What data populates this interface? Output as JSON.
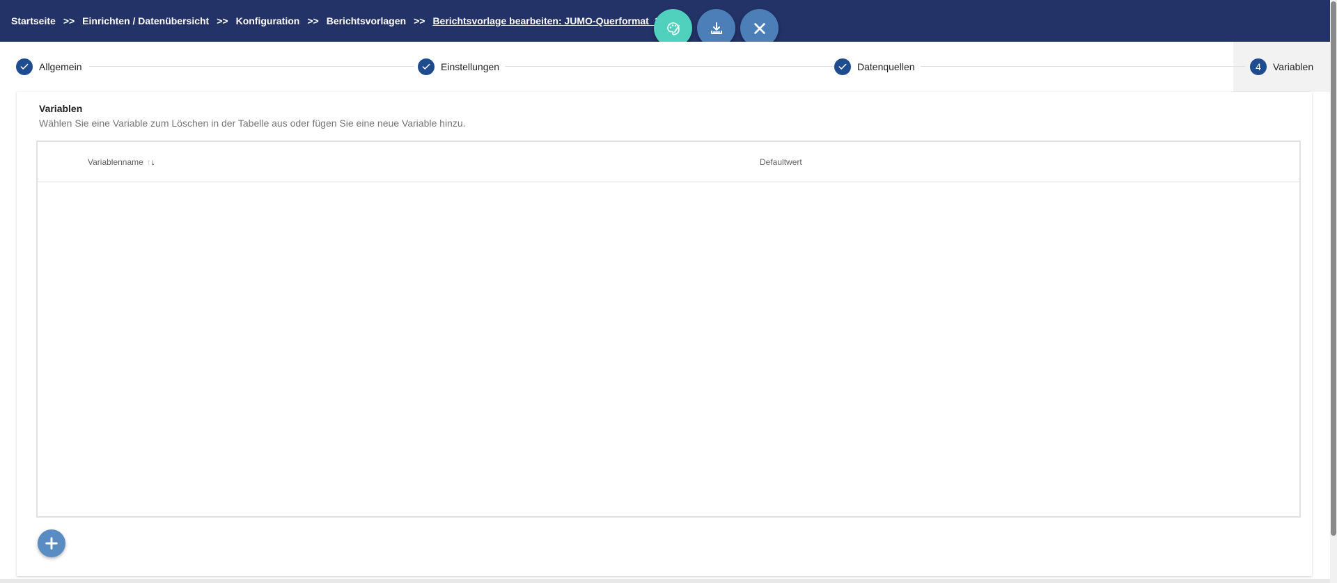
{
  "breadcrumb": {
    "items": [
      "Startseite",
      "Einrichten / Datenübersicht",
      "Konfiguration",
      "Berichtsvorlagen"
    ],
    "current": "Berichtsvorlage bearbeiten: JUMO-Querformat_1",
    "separator": ">>"
  },
  "toolbar": {
    "buttons": [
      {
        "icon": "paint-palette-icon",
        "color": "#4fd1bd"
      },
      {
        "icon": "download-icon",
        "color": "#4c7fb8"
      },
      {
        "icon": "close-icon",
        "color": "#4c7fb8"
      }
    ]
  },
  "stepper": {
    "steps": [
      {
        "label": "Allgemein",
        "state": "done"
      },
      {
        "label": "Einstellungen",
        "state": "done"
      },
      {
        "label": "Datenquellen",
        "state": "done"
      },
      {
        "label": "Variablen",
        "state": "active",
        "number": "4"
      }
    ]
  },
  "section": {
    "title": "Variablen",
    "description": "Wählen Sie eine Variable zum Löschen in der Tabelle aus oder fügen Sie eine neue Variable hinzu."
  },
  "table": {
    "columns": [
      {
        "label": "Variablenname",
        "sorted": "desc"
      },
      {
        "label": "Defaultwert"
      }
    ],
    "rows": []
  },
  "colors": {
    "header_bg": "#233267",
    "step_circle": "#1f4b8f",
    "fab_teal": "#4fd1bd",
    "fab_blue": "#4c7fb8",
    "add_fab": "#5a8cc4"
  }
}
